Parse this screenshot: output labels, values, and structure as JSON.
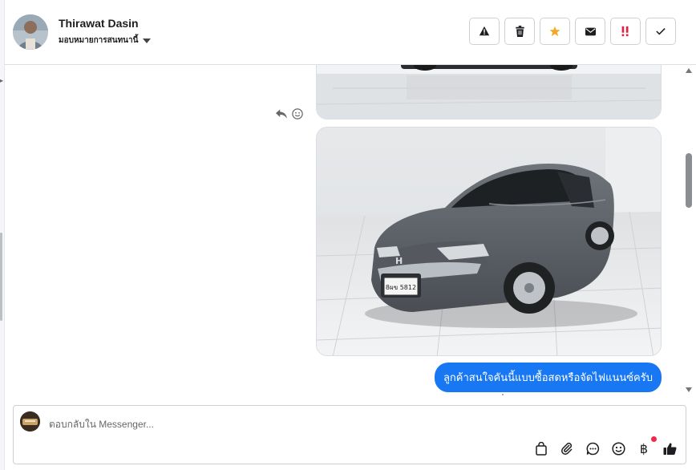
{
  "header": {
    "contact_name": "Thirawat Dasin",
    "assign_label": "มอบหมายการสนทนานี้",
    "actions": [
      {
        "name": "spam-icon",
        "label": "Mark as spam"
      },
      {
        "name": "trash-icon",
        "label": "Delete"
      },
      {
        "name": "star-icon",
        "label": "Star",
        "color": "#f5a623"
      },
      {
        "name": "envelope-icon",
        "label": "Mark as unread"
      },
      {
        "name": "priority-icon",
        "label": "Follow up",
        "color": "#e41e3f"
      },
      {
        "name": "check-icon",
        "label": "Mark as done"
      }
    ]
  },
  "thread": {
    "outgoing_message": "ลูกค้าสนใจคันนี้แบบซื้อสดหรือจัดไฟแนนซ์ครับ",
    "car_plate": "8ผข 5812",
    "bubble_color": "#1877f2"
  },
  "composer": {
    "placeholder": "ตอบกลับใน Messenger...",
    "tools": [
      "bag-icon",
      "paperclip-icon",
      "saved-reply-icon",
      "emoji-icon",
      "baht-icon",
      "thumbs-up-icon"
    ],
    "baht_symbol": "฿"
  }
}
